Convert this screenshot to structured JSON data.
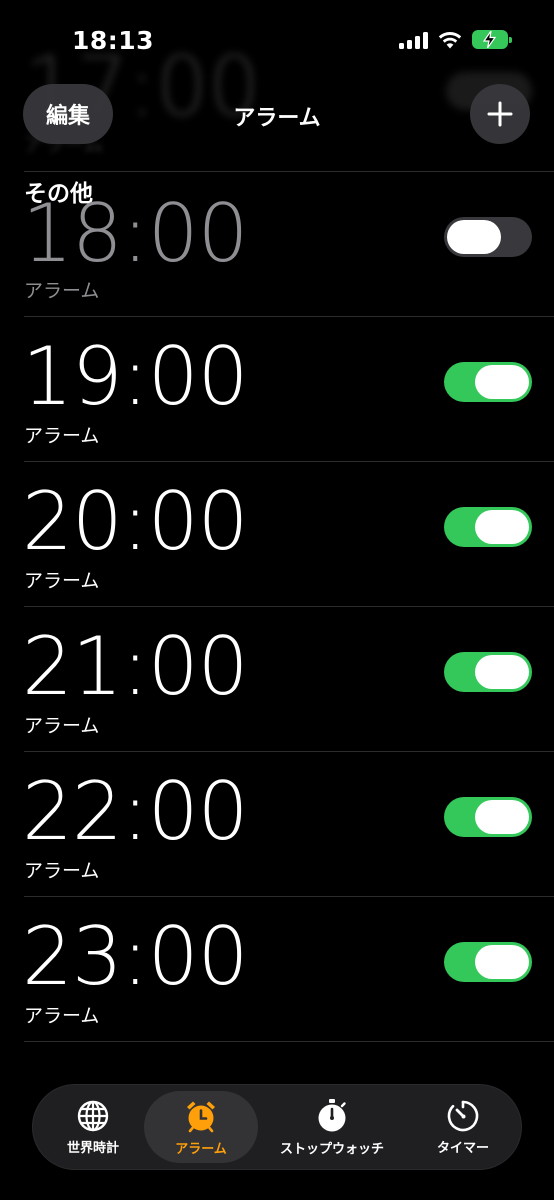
{
  "status_bar": {
    "time": "18:13",
    "icons": [
      "cellular-signal-icon",
      "wifi-icon",
      "battery-charging-icon"
    ],
    "battery_color": "#35c759"
  },
  "background_scroll": {
    "time": "17:00",
    "label": "アラーム"
  },
  "nav": {
    "edit_label": "編集",
    "title": "アラーム",
    "add_icon": "plus-icon"
  },
  "section": {
    "title": "その他"
  },
  "alarms": [
    {
      "time": "18:00",
      "label": "アラーム",
      "enabled": false
    },
    {
      "time": "19:00",
      "label": "アラーム",
      "enabled": true
    },
    {
      "time": "20:00",
      "label": "アラーム",
      "enabled": true
    },
    {
      "time": "21:00",
      "label": "アラーム",
      "enabled": true
    },
    {
      "time": "22:00",
      "label": "アラーム",
      "enabled": true
    },
    {
      "time": "23:00",
      "label": "アラーム",
      "enabled": true
    }
  ],
  "tabs": [
    {
      "label": "世界時計",
      "icon": "globe-icon",
      "active": false
    },
    {
      "label": "アラーム",
      "icon": "alarm-clock-icon",
      "active": true
    },
    {
      "label": "ストップウォッチ",
      "icon": "stopwatch-icon",
      "active": false
    },
    {
      "label": "タイマー",
      "icon": "timer-icon",
      "active": false
    }
  ],
  "colors": {
    "toggle_on": "#34c759",
    "toggle_off": "#39393d",
    "accent": "#ff9f0a",
    "background": "#000000"
  }
}
